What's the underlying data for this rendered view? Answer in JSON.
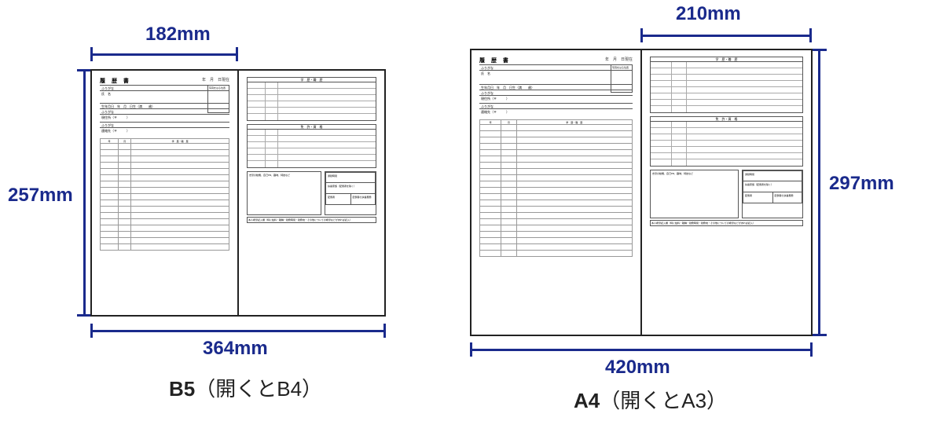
{
  "left": {
    "width_top": "182mm",
    "height_left": "257mm",
    "width_bottom": "364mm",
    "caption_bold": "B5",
    "caption_rest": "（開くとB4）"
  },
  "right": {
    "width_top": "210mm",
    "height_right": "297mm",
    "width_bottom": "420mm",
    "caption_bold": "A4",
    "caption_rest": "（開くとA3）"
  },
  "sheet": {
    "title": "履 歴 書",
    "date_suffix": "年　月　日現在",
    "photo_note": "写真をはる位置",
    "furigana": "ふりがな",
    "name": "氏　名",
    "birth": "生年月日",
    "birth_suffix": "年　月　日生（満　　歳）",
    "sex": "性別",
    "addr": "現住所（〒　　　）",
    "phone": "電話",
    "contact": "連絡先（〒　　　）",
    "col_year": "年",
    "col_month": "月",
    "sec_edu": "学　歴・職　歴",
    "sec_lic": "免　許・資　格",
    "sec_motive": "志望の動機、自己PR、趣味、特技など",
    "commute": "通勤時間",
    "dependents": "扶養家族（配偶者を除く）",
    "spouse": "配偶者",
    "spouse_support": "配偶者の扶養義務",
    "wish": "本人希望記入欄（特に給料・職種・勤務時間・勤務地・その他についての希望などがあれば記入）"
  }
}
